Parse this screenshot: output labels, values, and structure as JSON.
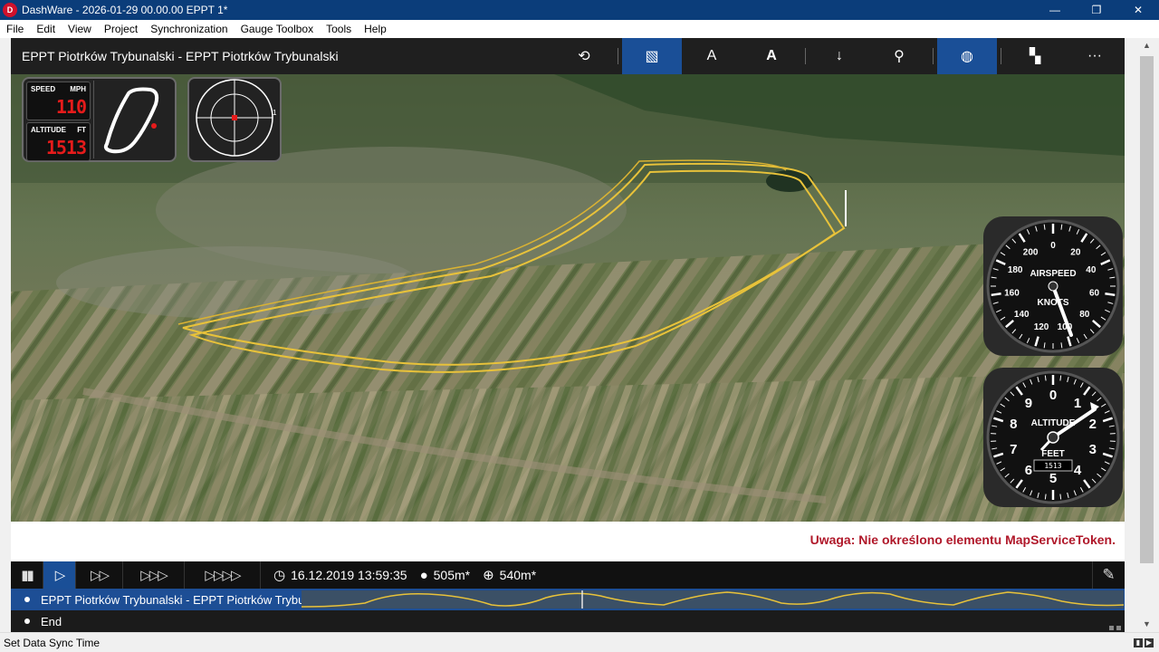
{
  "window": {
    "title": "DashWare - 2026-01-29 00.00.00 EPPT 1*",
    "app_icon_glyph": "D",
    "controls": [
      "—",
      "❐",
      "✕"
    ]
  },
  "menu": [
    "File",
    "Edit",
    "View",
    "Project",
    "Synchronization",
    "Gauge Toolbox",
    "Tools",
    "Help"
  ],
  "view": {
    "title": "EPPT Piotrków Trybunalski - EPPT Piotrków Trybunalski",
    "tools": [
      {
        "name": "edit-script-icon",
        "glyph": "⟲",
        "active": false
      },
      {
        "name": "map-view-icon",
        "glyph": "▧",
        "active": true
      },
      {
        "name": "outlined-text-icon",
        "glyph": "A",
        "active": false
      },
      {
        "name": "filled-text-icon",
        "glyph": "A",
        "active": false
      },
      {
        "name": "download-icon",
        "glyph": "↓",
        "active": false
      },
      {
        "name": "pin-icon",
        "glyph": "⚲",
        "active": false
      },
      {
        "name": "globe-icon",
        "glyph": "◍",
        "active": true
      },
      {
        "name": "gauge-settings-icon",
        "glyph": "▚",
        "active": false
      },
      {
        "name": "more-icon",
        "glyph": "···",
        "active": false
      }
    ]
  },
  "gauges": {
    "speed": {
      "label": "SPEED",
      "unit": "MPH",
      "value": "110"
    },
    "altitude": {
      "label": "ALTITUDE",
      "unit": "FT",
      "value": "1513"
    },
    "compass_mark": "1",
    "airspeed": {
      "title": "AIRSPEED",
      "units": "KNOTS",
      "scale": [
        "0",
        "20",
        "40",
        "60",
        "80",
        "100",
        "120",
        "140",
        "160",
        "180",
        "200"
      ]
    },
    "altimeter": {
      "title": "ALTITUDE",
      "units": "FEET",
      "readout": "1513",
      "scale": [
        "0",
        "1",
        "2",
        "3",
        "4",
        "5",
        "6",
        "7",
        "8",
        "9"
      ]
    }
  },
  "warning": "Uwaga: Nie określono elementu MapServiceToken.",
  "transport": {
    "pause_glyph": "▮▮",
    "play_glyph": "▷",
    "ff2_glyph": "▷▷",
    "ff3_glyph": "▷▷▷",
    "ff4_glyph": "▷▷▷▷",
    "datetime": "16.12.2019 13:59:35",
    "altitude": "505m*",
    "elevation": "540m*",
    "wrench_glyph": "🔧"
  },
  "timeline": {
    "rows": [
      {
        "label": "EPPT Piotrków Trybunalski - EPPT Piotrków Trybunalski",
        "selected": true
      },
      {
        "label": "End",
        "selected": false
      }
    ]
  },
  "status": {
    "text": "Set Data Sync Time"
  },
  "colors": {
    "accent": "#1a4f97",
    "title_bar": "#0b3d7a",
    "warning_text": "#b0182a",
    "track": "#e8c23a",
    "lcd_text": "#e51b1b"
  }
}
